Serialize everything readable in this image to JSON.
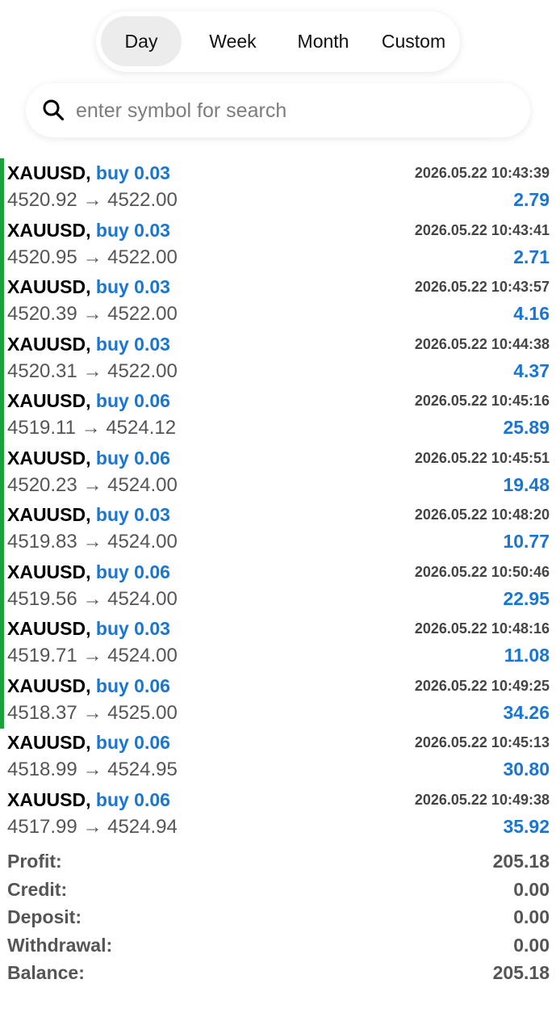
{
  "period_tabs": [
    {
      "label": "Day",
      "active": true
    },
    {
      "label": "Week",
      "active": false
    },
    {
      "label": "Month",
      "active": false
    },
    {
      "label": "Custom",
      "active": false
    }
  ],
  "search": {
    "placeholder": "enter symbol for search",
    "icon": "search-icon"
  },
  "colors": {
    "accent": "#1976d2",
    "open_position_marker": "#1aa13a"
  },
  "trades": [
    {
      "symbol": "XAUUSD,",
      "side": "buy 0.03",
      "open_price": "4520.92",
      "close_price": "4522.00",
      "time": "2026.05.22 10:43:39",
      "profit": "2.79",
      "marked": true
    },
    {
      "symbol": "XAUUSD,",
      "side": "buy 0.03",
      "open_price": "4520.95",
      "close_price": "4522.00",
      "time": "2026.05.22 10:43:41",
      "profit": "2.71",
      "marked": true
    },
    {
      "symbol": "XAUUSD,",
      "side": "buy 0.03",
      "open_price": "4520.39",
      "close_price": "4522.00",
      "time": "2026.05.22 10:43:57",
      "profit": "4.16",
      "marked": true
    },
    {
      "symbol": "XAUUSD,",
      "side": "buy 0.03",
      "open_price": "4520.31",
      "close_price": "4522.00",
      "time": "2026.05.22 10:44:38",
      "profit": "4.37",
      "marked": true
    },
    {
      "symbol": "XAUUSD,",
      "side": "buy 0.06",
      "open_price": "4519.11",
      "close_price": "4524.12",
      "time": "2026.05.22 10:45:16",
      "profit": "25.89",
      "marked": true
    },
    {
      "symbol": "XAUUSD,",
      "side": "buy 0.06",
      "open_price": "4520.23",
      "close_price": "4524.00",
      "time": "2026.05.22 10:45:51",
      "profit": "19.48",
      "marked": true
    },
    {
      "symbol": "XAUUSD,",
      "side": "buy 0.03",
      "open_price": "4519.83",
      "close_price": "4524.00",
      "time": "2026.05.22 10:48:20",
      "profit": "10.77",
      "marked": true
    },
    {
      "symbol": "XAUUSD,",
      "side": "buy 0.06",
      "open_price": "4519.56",
      "close_price": "4524.00",
      "time": "2026.05.22 10:50:46",
      "profit": "22.95",
      "marked": true
    },
    {
      "symbol": "XAUUSD,",
      "side": "buy 0.03",
      "open_price": "4519.71",
      "close_price": "4524.00",
      "time": "2026.05.22 10:48:16",
      "profit": "11.08",
      "marked": true
    },
    {
      "symbol": "XAUUSD,",
      "side": "buy 0.06",
      "open_price": "4518.37",
      "close_price": "4525.00",
      "time": "2026.05.22 10:49:25",
      "profit": "34.26",
      "marked": true
    },
    {
      "symbol": "XAUUSD,",
      "side": "buy 0.06",
      "open_price": "4518.99",
      "close_price": "4524.95",
      "time": "2026.05.22 10:45:13",
      "profit": "30.80",
      "marked": false
    },
    {
      "symbol": "XAUUSD,",
      "side": "buy 0.06",
      "open_price": "4517.99",
      "close_price": "4524.94",
      "time": "2026.05.22 10:49:38",
      "profit": "35.92",
      "marked": false
    }
  ],
  "price_arrow": "→",
  "summary": [
    {
      "label": "Profit:",
      "value": "205.18"
    },
    {
      "label": "Credit:",
      "value": "0.00"
    },
    {
      "label": "Deposit:",
      "value": "0.00"
    },
    {
      "label": "Withdrawal:",
      "value": "0.00"
    },
    {
      "label": "Balance:",
      "value": "205.18"
    }
  ]
}
